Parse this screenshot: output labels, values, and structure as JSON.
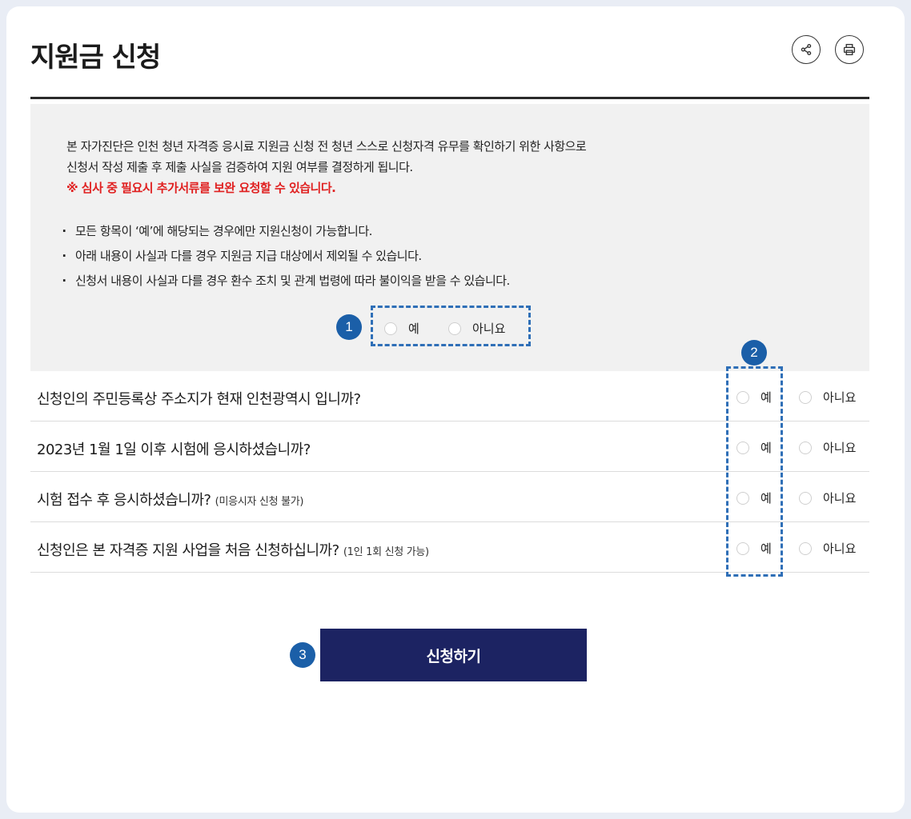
{
  "header": {
    "title": "지원금 신청",
    "share_icon": "share-icon",
    "print_icon": "print-icon"
  },
  "notice": {
    "intro_line1": "본 자가진단은 인천 청년 자격증 응시료 지원금 신청 전 청년 스스로 신청자격 유무를 확인하기 위한 사항으로",
    "intro_line2": "신청서 작성 제출 후 제출 사실을 검증하여 지원 여부를 결정하게 됩니다.",
    "warning": "※ 심사 중 필요시 추가서류를 보완 요청할 수 있습니다.",
    "bullets": [
      "모든 항목이 ‘예’에 해당되는 경우에만 지원신청이 가능합니다.",
      "아래 내용이 사실과 다를 경우 지원금 지급 대상에서 제외될 수 있습니다.",
      "신청서 내용이 사실과 다를 경우 환수 조치 및 관계 법령에 따라 불이익을 받을 수 있습니다."
    ],
    "yes": "예",
    "no": "아니요"
  },
  "questions": [
    {
      "text": "신청인의 주민등록상 주소지가 현재 인천광역시 입니까?",
      "note": "",
      "yes": "예",
      "no": "아니요"
    },
    {
      "text": "2023년 1월 1일 이후 시험에 응시하셨습니까?",
      "note": "",
      "yes": "예",
      "no": "아니요"
    },
    {
      "text": "시험 접수 후 응시하셨습니까?",
      "note": "(미응시자 신청 불가)",
      "yes": "예",
      "no": "아니요"
    },
    {
      "text": "신청인은 본 자격증 지원 사업을 처음 신청하십니까?",
      "note": "(1인 1회 신청 가능)",
      "yes": "예",
      "no": "아니요"
    }
  ],
  "submit_label": "신청하기",
  "annotations": {
    "badge1": "1",
    "badge2": "2",
    "badge3": "3"
  },
  "colors": {
    "badge": "#1b5fa8",
    "submit_bg": "#1c2362",
    "warning": "#e02020",
    "dash": "#2f6fb7"
  }
}
